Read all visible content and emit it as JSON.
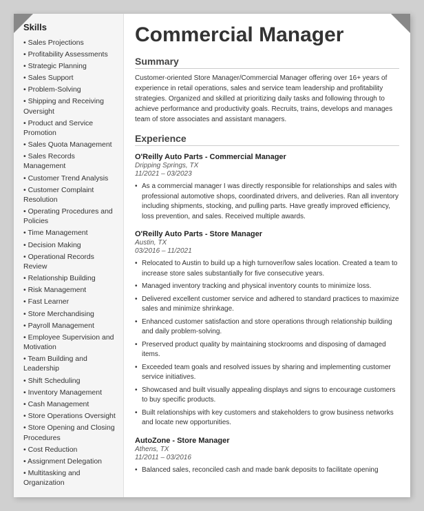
{
  "page": {
    "title": "Commercial Manager",
    "corners": true
  },
  "sidebar": {
    "title": "Skills",
    "items": [
      "Sales Projections",
      "Profitability Assessments",
      "Strategic Planning",
      "Sales Support",
      "Problem-Solving",
      "Shipping and Receiving Oversight",
      "Product and Service Promotion",
      "Sales Quota Management",
      "Sales Records Management",
      "Customer Trend Analysis",
      "Customer Complaint Resolution",
      "Operating Procedures and Policies",
      "Time Management",
      "Decision Making",
      "Operational Records Review",
      "Relationship Building",
      "Risk Management",
      "Fast Learner",
      "Store Merchandising",
      "Payroll Management",
      "Employee Supervision and Motivation",
      "Team Building and Leadership",
      "Shift Scheduling",
      "Inventory Management",
      "Cash Management",
      "Store Operations Oversight",
      "Store Opening and Closing Procedures",
      "Cost Reduction",
      "Assignment Delegation",
      "Multitasking and Organization"
    ]
  },
  "summary": {
    "heading": "Summary",
    "text": "Customer-oriented Store Manager/Commercial Manager offering over 16+ years of experience in retail operations, sales and service team leadership and profitability strategies. Organized and skilled at prioritizing daily tasks and following through to achieve performance and productivity goals. Recruits, trains, develops and manages team of store associates and assistant managers."
  },
  "experience": {
    "heading": "Experience",
    "jobs": [
      {
        "title": "O'Reilly Auto Parts - Commercial Manager",
        "location": "Dripping Springs, TX",
        "dates": "11/2021 – 03/2023",
        "bullets": [
          "As a commercial manager I was directly responsible for relationships and sales with professional automotive shops, coordinated drivers, and deliveries. Ran all inventory including shipments, stocking, and pulling parts. Have greatly improved efficiency, loss prevention, and sales. Received multiple awards."
        ]
      },
      {
        "title": "O'Reilly Auto Parts - Store Manager",
        "location": "Austin, TX",
        "dates": "03/2016 – 11/2021",
        "bullets": [
          "Relocated to Austin to build up a high turnover/low sales location. Created a team to increase store sales substantially for five consecutive years.",
          "Managed inventory tracking and physical inventory counts to minimize loss.",
          "Delivered excellent customer service and adhered to standard practices to maximize sales and minimize shrinkage.",
          "Enhanced customer satisfaction and store operations through relationship building and daily problem-solving.",
          "Preserved product quality by maintaining stockrooms and disposing of damaged items.",
          "Exceeded team goals and resolved issues by sharing and implementing customer service initiatives.",
          "Showcased and built visually appealing displays and signs to encourage customers to buy specific products.",
          "Built relationships with key customers and stakeholders to grow business networks and locate new opportunities."
        ]
      },
      {
        "title": "AutoZone - Store Manager",
        "location": "Athens, TX",
        "dates": "11/2011 – 03/2016",
        "bullets": [
          "Balanced sales, reconciled cash and made bank deposits to facilitate opening"
        ]
      }
    ]
  }
}
